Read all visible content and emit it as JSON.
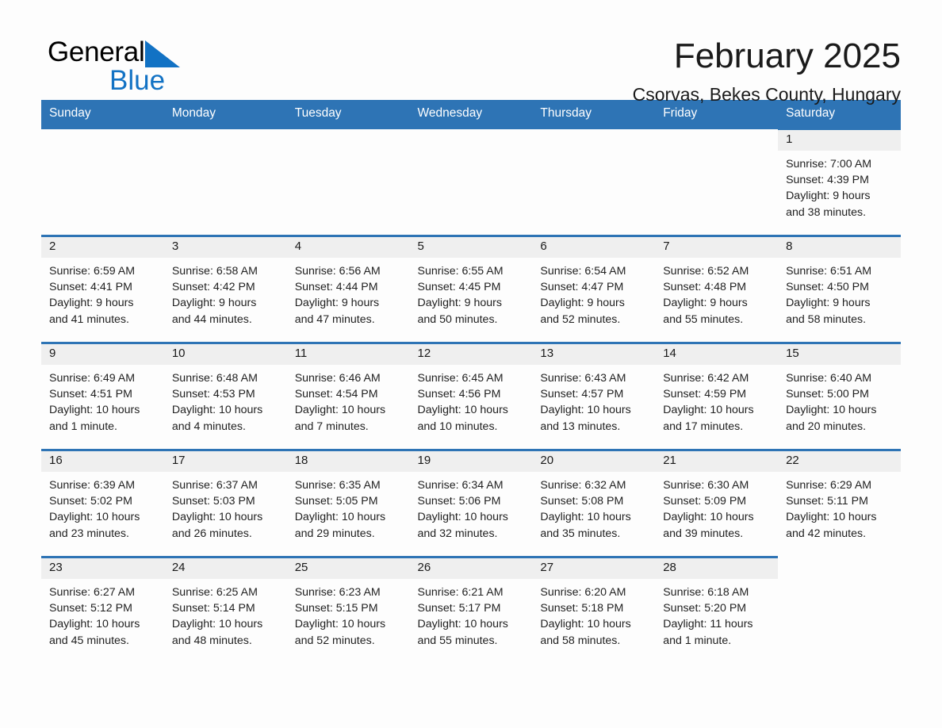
{
  "brand": {
    "name_part1": "General",
    "name_part2": "Blue",
    "logo_icon": "triangle-icon",
    "accent_color": "#1272c4"
  },
  "header": {
    "title": "February 2025",
    "subtitle": "Csorvas, Bekes County, Hungary"
  },
  "theme": {
    "header_blue": "#2e74b5",
    "daynum_band": "#efefef",
    "page_background": "#fdfdfd"
  },
  "calendar": {
    "weekday_headers": [
      "Sunday",
      "Monday",
      "Tuesday",
      "Wednesday",
      "Thursday",
      "Friday",
      "Saturday"
    ],
    "weeks": [
      [
        {
          "day": "",
          "lines": []
        },
        {
          "day": "",
          "lines": []
        },
        {
          "day": "",
          "lines": []
        },
        {
          "day": "",
          "lines": []
        },
        {
          "day": "",
          "lines": []
        },
        {
          "day": "",
          "lines": []
        },
        {
          "day": "1",
          "lines": [
            "Sunrise: 7:00 AM",
            "Sunset: 4:39 PM",
            "Daylight: 9 hours",
            "and 38 minutes."
          ]
        }
      ],
      [
        {
          "day": "2",
          "lines": [
            "Sunrise: 6:59 AM",
            "Sunset: 4:41 PM",
            "Daylight: 9 hours",
            "and 41 minutes."
          ]
        },
        {
          "day": "3",
          "lines": [
            "Sunrise: 6:58 AM",
            "Sunset: 4:42 PM",
            "Daylight: 9 hours",
            "and 44 minutes."
          ]
        },
        {
          "day": "4",
          "lines": [
            "Sunrise: 6:56 AM",
            "Sunset: 4:44 PM",
            "Daylight: 9 hours",
            "and 47 minutes."
          ]
        },
        {
          "day": "5",
          "lines": [
            "Sunrise: 6:55 AM",
            "Sunset: 4:45 PM",
            "Daylight: 9 hours",
            "and 50 minutes."
          ]
        },
        {
          "day": "6",
          "lines": [
            "Sunrise: 6:54 AM",
            "Sunset: 4:47 PM",
            "Daylight: 9 hours",
            "and 52 minutes."
          ]
        },
        {
          "day": "7",
          "lines": [
            "Sunrise: 6:52 AM",
            "Sunset: 4:48 PM",
            "Daylight: 9 hours",
            "and 55 minutes."
          ]
        },
        {
          "day": "8",
          "lines": [
            "Sunrise: 6:51 AM",
            "Sunset: 4:50 PM",
            "Daylight: 9 hours",
            "and 58 minutes."
          ]
        }
      ],
      [
        {
          "day": "9",
          "lines": [
            "Sunrise: 6:49 AM",
            "Sunset: 4:51 PM",
            "Daylight: 10 hours",
            "and 1 minute."
          ]
        },
        {
          "day": "10",
          "lines": [
            "Sunrise: 6:48 AM",
            "Sunset: 4:53 PM",
            "Daylight: 10 hours",
            "and 4 minutes."
          ]
        },
        {
          "day": "11",
          "lines": [
            "Sunrise: 6:46 AM",
            "Sunset: 4:54 PM",
            "Daylight: 10 hours",
            "and 7 minutes."
          ]
        },
        {
          "day": "12",
          "lines": [
            "Sunrise: 6:45 AM",
            "Sunset: 4:56 PM",
            "Daylight: 10 hours",
            "and 10 minutes."
          ]
        },
        {
          "day": "13",
          "lines": [
            "Sunrise: 6:43 AM",
            "Sunset: 4:57 PM",
            "Daylight: 10 hours",
            "and 13 minutes."
          ]
        },
        {
          "day": "14",
          "lines": [
            "Sunrise: 6:42 AM",
            "Sunset: 4:59 PM",
            "Daylight: 10 hours",
            "and 17 minutes."
          ]
        },
        {
          "day": "15",
          "lines": [
            "Sunrise: 6:40 AM",
            "Sunset: 5:00 PM",
            "Daylight: 10 hours",
            "and 20 minutes."
          ]
        }
      ],
      [
        {
          "day": "16",
          "lines": [
            "Sunrise: 6:39 AM",
            "Sunset: 5:02 PM",
            "Daylight: 10 hours",
            "and 23 minutes."
          ]
        },
        {
          "day": "17",
          "lines": [
            "Sunrise: 6:37 AM",
            "Sunset: 5:03 PM",
            "Daylight: 10 hours",
            "and 26 minutes."
          ]
        },
        {
          "day": "18",
          "lines": [
            "Sunrise: 6:35 AM",
            "Sunset: 5:05 PM",
            "Daylight: 10 hours",
            "and 29 minutes."
          ]
        },
        {
          "day": "19",
          "lines": [
            "Sunrise: 6:34 AM",
            "Sunset: 5:06 PM",
            "Daylight: 10 hours",
            "and 32 minutes."
          ]
        },
        {
          "day": "20",
          "lines": [
            "Sunrise: 6:32 AM",
            "Sunset: 5:08 PM",
            "Daylight: 10 hours",
            "and 35 minutes."
          ]
        },
        {
          "day": "21",
          "lines": [
            "Sunrise: 6:30 AM",
            "Sunset: 5:09 PM",
            "Daylight: 10 hours",
            "and 39 minutes."
          ]
        },
        {
          "day": "22",
          "lines": [
            "Sunrise: 6:29 AM",
            "Sunset: 5:11 PM",
            "Daylight: 10 hours",
            "and 42 minutes."
          ]
        }
      ],
      [
        {
          "day": "23",
          "lines": [
            "Sunrise: 6:27 AM",
            "Sunset: 5:12 PM",
            "Daylight: 10 hours",
            "and 45 minutes."
          ]
        },
        {
          "day": "24",
          "lines": [
            "Sunrise: 6:25 AM",
            "Sunset: 5:14 PM",
            "Daylight: 10 hours",
            "and 48 minutes."
          ]
        },
        {
          "day": "25",
          "lines": [
            "Sunrise: 6:23 AM",
            "Sunset: 5:15 PM",
            "Daylight: 10 hours",
            "and 52 minutes."
          ]
        },
        {
          "day": "26",
          "lines": [
            "Sunrise: 6:21 AM",
            "Sunset: 5:17 PM",
            "Daylight: 10 hours",
            "and 55 minutes."
          ]
        },
        {
          "day": "27",
          "lines": [
            "Sunrise: 6:20 AM",
            "Sunset: 5:18 PM",
            "Daylight: 10 hours",
            "and 58 minutes."
          ]
        },
        {
          "day": "28",
          "lines": [
            "Sunrise: 6:18 AM",
            "Sunset: 5:20 PM",
            "Daylight: 11 hours",
            "and 1 minute."
          ]
        },
        {
          "day": "",
          "lines": []
        }
      ]
    ]
  }
}
